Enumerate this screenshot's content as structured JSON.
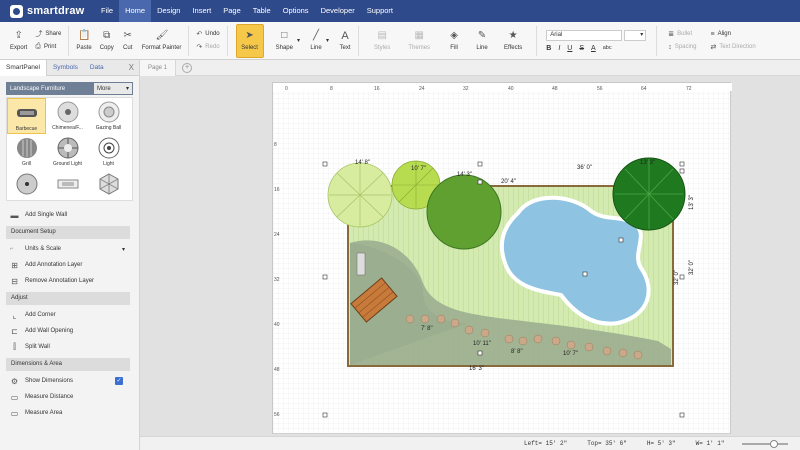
{
  "app": {
    "name": "smartdraw"
  },
  "menu": [
    "File",
    "Home",
    "Design",
    "Insert",
    "Page",
    "Table",
    "Options",
    "Developer",
    "Support"
  ],
  "ribbon": {
    "export": "Export",
    "share": "Share",
    "print": "Print",
    "paste": "Paste",
    "copy": "Copy",
    "cut": "Cut",
    "format_painter": "Format Painter",
    "undo": "Undo",
    "redo": "Redo",
    "select": "Select",
    "shape": "Shape",
    "line": "Line",
    "text": "Text",
    "styles": "Styles",
    "themes": "Themes",
    "fill": "Fill",
    "line_style": "Line",
    "effects": "Effects",
    "font": "Arial",
    "font_size": "",
    "bold": "B",
    "italic": "I",
    "underline": "U",
    "strike": "S",
    "font_color": "A",
    "abc": "abc",
    "bullet": "Bullet",
    "align": "Align",
    "spacing": "Spacing",
    "text_direction": "Text Direction"
  },
  "panel": {
    "tabs": [
      "SmartPanel",
      "Symbols",
      "Data"
    ],
    "close": "X",
    "library": "Landscape Furniture",
    "more": "More",
    "shapes": [
      "Barbecue",
      "Chimenea/F...",
      "Gazing Ball",
      "Grill",
      "Ground Light",
      "Light",
      "",
      "",
      ""
    ],
    "add_single_wall": "Add Single Wall",
    "document_setup": "Document Setup",
    "units_scale": "Units & Scale",
    "add_annotation_layer": "Add Annotation Layer",
    "remove_annotation_layer": "Remove Annotation Layer",
    "adjust": "Adjust",
    "add_corner": "Add Corner",
    "add_wall_opening": "Add Wall Opening",
    "split_wall": "Split Wall",
    "dimensions_area": "Dimensions & Area",
    "show_dimensions": "Show Dimensions",
    "measure_distance": "Measure Distance",
    "measure_area": "Measure Area"
  },
  "pages": {
    "page1": "Page 1",
    "add": "+"
  },
  "ruler_top": [
    "0",
    "8",
    "16",
    "24",
    "32",
    "40",
    "48",
    "56",
    "64",
    "72"
  ],
  "ruler_left": [
    "8",
    "16",
    "24",
    "32",
    "40",
    "48",
    "56"
  ],
  "dimensions": [
    "14' 8\"",
    "10' 7\"",
    "14' 3\"",
    "36' 0\"",
    "13' 3\"",
    "13' 3\"",
    "20' 4\"",
    "32' 0\"",
    "32' 0\"",
    "7' 8\"",
    "10' 11\"",
    "8' 8\"",
    "10' 7\"",
    "16' 3\""
  ],
  "status": {
    "left": "Left= 15' 2\"",
    "top": "Top= 35' 6\"",
    "h": "H= 5' 3\"",
    "w": "W= 1' 1\""
  },
  "colors": {
    "topbar": "#2f4a8a",
    "lawn": "#cde8a8",
    "path": "#98aa8c",
    "pool": "#8fc3e2",
    "deck": "#c87a3a"
  }
}
